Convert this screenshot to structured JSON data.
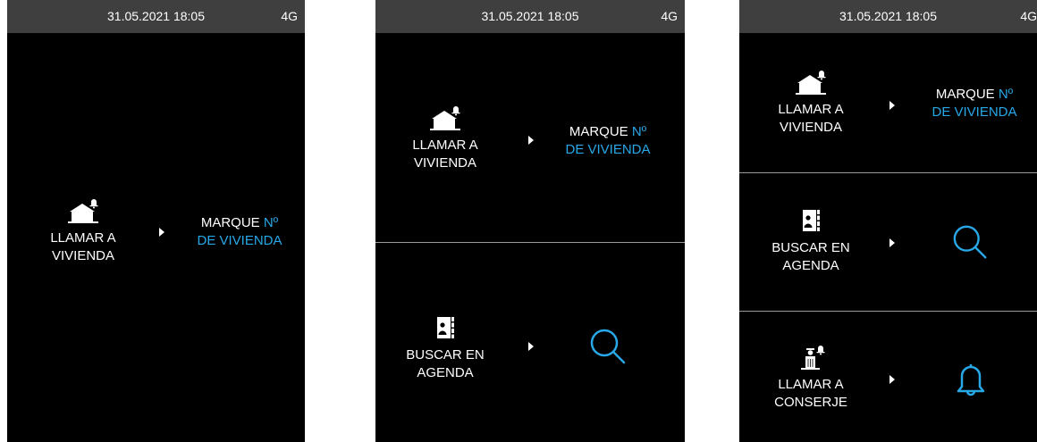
{
  "colors": {
    "accent": "#29a8e8",
    "background": "#000000",
    "statusbar": "#3f3f3f",
    "divider": "#9a9a9a"
  },
  "status": {
    "datetime": "31.05.2021  18:05",
    "network": "4G"
  },
  "screens": [
    {
      "options": [
        {
          "icon": "house-bell-icon",
          "label": "LLAMAR A\nVIVIENDA",
          "hint_white": "MARQUE ",
          "hint_blue_1": "Nº",
          "hint_blue_2": "DE VIVIENDA"
        }
      ]
    },
    {
      "options": [
        {
          "icon": "house-bell-icon",
          "label": "LLAMAR A\nVIVIENDA",
          "hint_white": "MARQUE ",
          "hint_blue_1": "Nº",
          "hint_blue_2": "DE VIVIENDA"
        },
        {
          "icon": "address-book-icon",
          "label": "BUSCAR EN\nAGENDA",
          "action_icon": "search-icon"
        }
      ]
    },
    {
      "options": [
        {
          "icon": "house-bell-icon",
          "label": "LLAMAR A\nVIVIENDA",
          "hint_white": "MARQUE ",
          "hint_blue_1": "Nº",
          "hint_blue_2": "DE VIVIENDA"
        },
        {
          "icon": "address-book-icon",
          "label": "BUSCAR EN\nAGENDA",
          "action_icon": "search-icon"
        },
        {
          "icon": "concierge-icon",
          "label": "LLAMAR A\nCONSERJE",
          "action_icon": "bell-icon"
        }
      ]
    }
  ]
}
